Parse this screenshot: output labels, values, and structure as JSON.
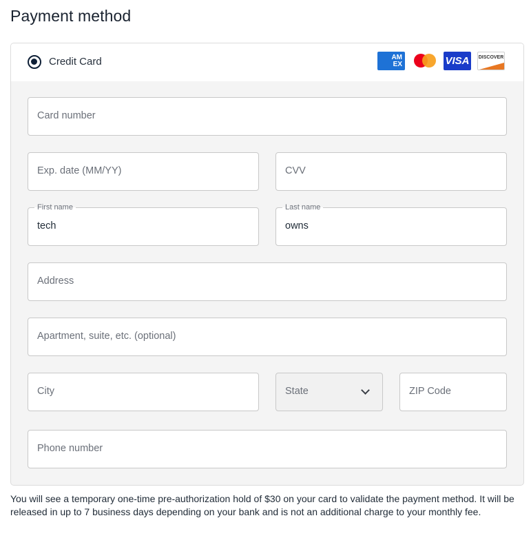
{
  "page": {
    "title": "Payment method"
  },
  "payment_option": {
    "label": "Credit Card",
    "selected": true,
    "card_logos": [
      {
        "name": "amex",
        "text": "AM EX"
      },
      {
        "name": "mastercard",
        "text": ""
      },
      {
        "name": "visa",
        "text": "VISA"
      },
      {
        "name": "discover",
        "text": "DISCOVER"
      }
    ]
  },
  "form": {
    "card_number": {
      "placeholder": "Card number",
      "value": ""
    },
    "exp_date": {
      "placeholder": "Exp. date (MM/YY)",
      "value": ""
    },
    "cvv": {
      "placeholder": "CVV",
      "value": ""
    },
    "first_name": {
      "label": "First name",
      "value": "tech"
    },
    "last_name": {
      "label": "Last name",
      "value": "owns"
    },
    "address": {
      "placeholder": "Address",
      "value": ""
    },
    "apartment": {
      "placeholder": "Apartment, suite, etc. (optional)",
      "value": ""
    },
    "city": {
      "placeholder": "City",
      "value": ""
    },
    "state": {
      "placeholder": "State",
      "selected": ""
    },
    "zip": {
      "placeholder": "ZIP Code",
      "value": ""
    },
    "phone": {
      "placeholder": "Phone number",
      "value": ""
    }
  },
  "note": "You will see a temporary one-time pre-authorization hold of $30 on your card to validate the payment method. It will be released in up to 7 business days depending on your bank and is not an additional charge to your monthly fee."
}
